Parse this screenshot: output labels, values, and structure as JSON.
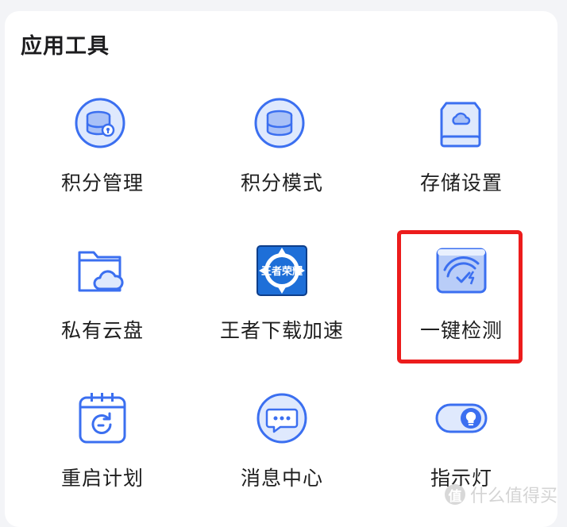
{
  "section": {
    "title": "应用工具"
  },
  "tools": [
    {
      "label": "积分管理",
      "icon": "points-management-icon"
    },
    {
      "label": "积分模式",
      "icon": "points-mode-icon"
    },
    {
      "label": "存储设置",
      "icon": "storage-settings-icon"
    },
    {
      "label": "私有云盘",
      "icon": "private-cloud-drive-icon"
    },
    {
      "label": "王者下载加速",
      "icon": "game-download-accel-icon",
      "icon_text": "王者荣耀"
    },
    {
      "label": "一键检测",
      "icon": "one-click-check-icon"
    },
    {
      "label": "重启计划",
      "icon": "reboot-schedule-icon"
    },
    {
      "label": "消息中心",
      "icon": "message-center-icon"
    },
    {
      "label": "指示灯",
      "icon": "indicator-light-icon"
    }
  ],
  "watermark": {
    "text": "什么值得买",
    "mark": "值"
  },
  "colors": {
    "icon_blue": "#3b6ff0",
    "icon_fill": "#dfe9fd",
    "highlight": "#ec1c1c"
  }
}
